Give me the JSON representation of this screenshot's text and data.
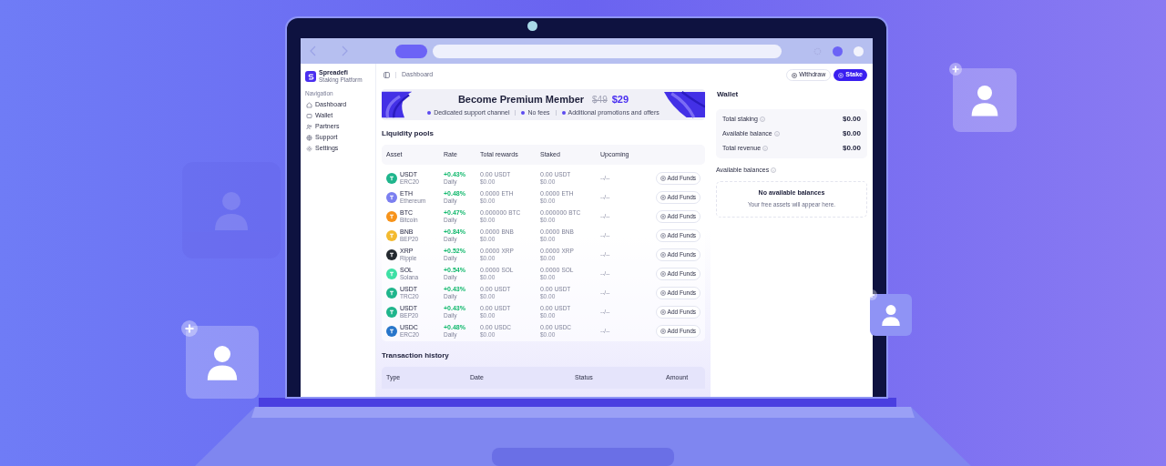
{
  "app": {
    "brand": {
      "name": "Spreadefi",
      "subtitle": "Staking Platform"
    },
    "nav_heading": "Navigation",
    "nav": [
      {
        "label": "Dashboard"
      },
      {
        "label": "Wallet"
      },
      {
        "label": "Partners"
      },
      {
        "label": "Support"
      },
      {
        "label": "Settings"
      }
    ],
    "breadcrumb": "Dashboard",
    "actions": [
      {
        "label": "Withdraw",
        "kind": "outline"
      },
      {
        "label": "Stake",
        "kind": "primary"
      }
    ],
    "banner": {
      "title": "Become Premium Member",
      "old_price": "$49",
      "price": "$29",
      "perks": [
        "Dedicated support channel",
        "No fees",
        "Additional promotions and offers"
      ]
    },
    "pools": {
      "title": "Liquidity pools",
      "columns": [
        "Asset",
        "Rate",
        "Total rewards",
        "Staked",
        "Upcoming"
      ],
      "rows": [
        {
          "symbol": "USDT",
          "network": "ERC20",
          "color": "#1fb58c",
          "rate": "+0.43%",
          "period": "Daily",
          "rewards": "0.00",
          "rewards_unit": "USDT",
          "rewards_usd": "$0.00",
          "staked": "0.00",
          "staked_unit": "USDT",
          "staked_usd": "$0.00",
          "upcoming": "--/--",
          "action": "Add Funds"
        },
        {
          "symbol": "ETH",
          "network": "Ethereum",
          "color": "#7b7ff0",
          "rate": "+0.48%",
          "period": "Daily",
          "rewards": "0.0000",
          "rewards_unit": "ETH",
          "rewards_usd": "$0.00",
          "staked": "0.0000",
          "staked_unit": "ETH",
          "staked_usd": "$0.00",
          "upcoming": "--/--",
          "action": "Add Funds"
        },
        {
          "symbol": "BTC",
          "network": "Bitcoin",
          "color": "#f7931a",
          "rate": "+0.47%",
          "period": "Daily",
          "rewards": "0.000000",
          "rewards_unit": "BTC",
          "rewards_usd": "$0.00",
          "staked": "0.000000",
          "staked_unit": "BTC",
          "staked_usd": "$0.00",
          "upcoming": "--/--",
          "action": "Add Funds"
        },
        {
          "symbol": "BNB",
          "network": "BEP20",
          "color": "#f3ba2f",
          "rate": "+0.84%",
          "period": "Daily",
          "rewards": "0.0000",
          "rewards_unit": "BNB",
          "rewards_usd": "$0.00",
          "staked": "0.0000",
          "staked_unit": "BNB",
          "staked_usd": "$0.00",
          "upcoming": "--/--",
          "action": "Add Funds"
        },
        {
          "symbol": "XRP",
          "network": "Ripple",
          "color": "#23292f",
          "rate": "+0.52%",
          "period": "Daily",
          "rewards": "0.0000",
          "rewards_unit": "XRP",
          "rewards_usd": "$0.00",
          "staked": "0.0000",
          "staked_unit": "XRP",
          "staked_usd": "$0.00",
          "upcoming": "--/--",
          "action": "Add Funds"
        },
        {
          "symbol": "SOL",
          "network": "Solana",
          "color": "#3ee0a5",
          "rate": "+0.54%",
          "period": "Daily",
          "rewards": "0.0000",
          "rewards_unit": "SOL",
          "rewards_usd": "$0.00",
          "staked": "0.0000",
          "staked_unit": "SOL",
          "staked_usd": "$0.00",
          "upcoming": "--/--",
          "action": "Add Funds"
        },
        {
          "symbol": "USDT",
          "network": "TRC20",
          "color": "#1fb58c",
          "rate": "+0.43%",
          "period": "Daily",
          "rewards": "0.00",
          "rewards_unit": "USDT",
          "rewards_usd": "$0.00",
          "staked": "0.00",
          "staked_unit": "USDT",
          "staked_usd": "$0.00",
          "upcoming": "--/--",
          "action": "Add Funds"
        },
        {
          "symbol": "USDT",
          "network": "BEP20",
          "color": "#1fb58c",
          "rate": "+0.43%",
          "period": "Daily",
          "rewards": "0.00",
          "rewards_unit": "USDT",
          "rewards_usd": "$0.00",
          "staked": "0.00",
          "staked_unit": "USDT",
          "staked_usd": "$0.00",
          "upcoming": "--/--",
          "action": "Add Funds"
        },
        {
          "symbol": "USDC",
          "network": "ERC20",
          "color": "#2775ca",
          "rate": "+0.48%",
          "period": "Daily",
          "rewards": "0.00",
          "rewards_unit": "USDC",
          "rewards_usd": "$0.00",
          "staked": "0.00",
          "staked_unit": "USDC",
          "staked_usd": "$0.00",
          "upcoming": "--/--",
          "action": "Add Funds"
        }
      ]
    },
    "transactions": {
      "title": "Transaction history",
      "columns": [
        "Type",
        "Date",
        "Status",
        "Amount"
      ]
    },
    "wallet": {
      "title": "Wallet",
      "stats": [
        {
          "label": "Total staking",
          "value": "$0.00"
        },
        {
          "label": "Available balance",
          "value": "$0.00"
        },
        {
          "label": "Total revenue",
          "value": "$0.00"
        }
      ],
      "balances_title": "Available balances",
      "empty_title": "No available balances",
      "empty_text": "Your free assets will appear here."
    }
  }
}
